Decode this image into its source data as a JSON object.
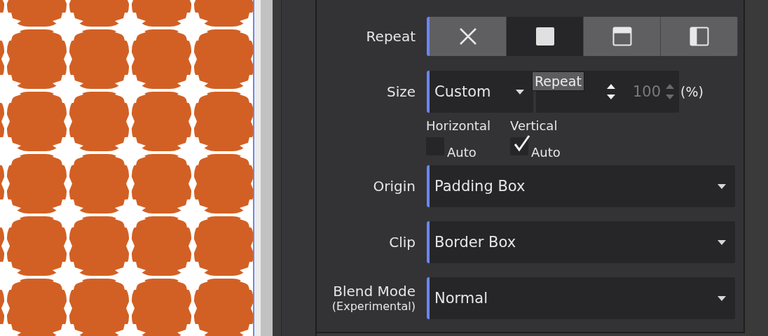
{
  "repeat": {
    "label": "Repeat",
    "options": [
      {
        "kind": "none",
        "selected": false
      },
      {
        "kind": "repeat",
        "selected": true
      },
      {
        "kind": "repeat-x",
        "selected": false
      },
      {
        "kind": "repeat-y",
        "selected": false
      }
    ]
  },
  "tooltip": "Repeat",
  "size": {
    "label": "Size",
    "mode": "Custom",
    "width": {
      "disabled": false
    },
    "height": {
      "value": "100",
      "disabled": true
    },
    "unit": "(%)",
    "auto": [
      {
        "label": "Horizontal",
        "checkbox_label": "Auto",
        "checked": false
      },
      {
        "label": "Vertical",
        "checkbox_label": "Auto",
        "checked": true
      }
    ]
  },
  "dropdowns": [
    {
      "label": "Origin",
      "value": "Padding Box"
    },
    {
      "label": "Clip",
      "value": "Border Box"
    },
    {
      "label": "Blend Mode",
      "sublabel": "(Experimental)",
      "value": "Normal"
    }
  ]
}
